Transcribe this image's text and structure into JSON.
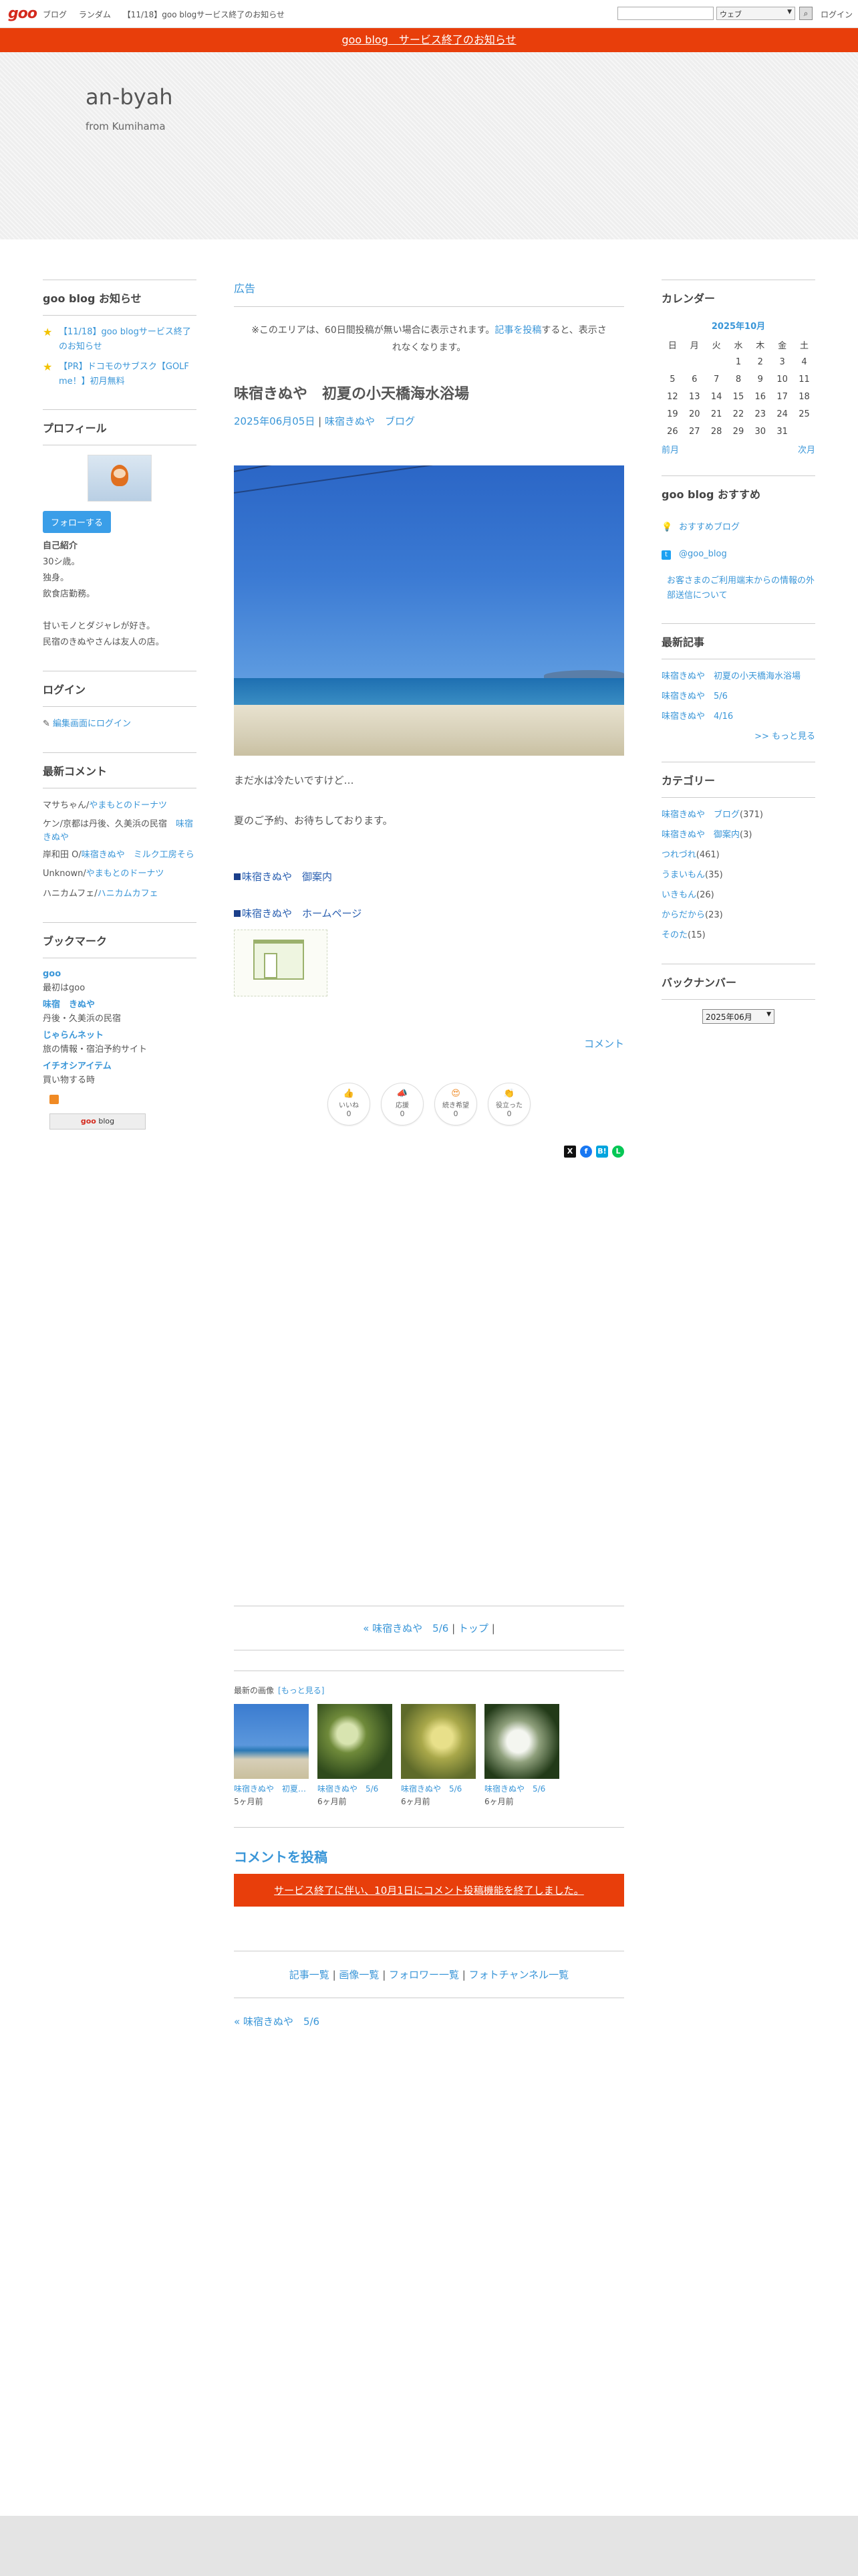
{
  "topbar": {
    "logo": "goo",
    "nav": [
      "ブログ",
      "ランダム",
      "【11/18】goo blogサービス終了のお知らせ"
    ],
    "search_select": "ウェブ",
    "search_button": "🔍",
    "login": "ログイン"
  },
  "notice": {
    "text": "goo blog　サービス終了のお知らせ"
  },
  "header": {
    "title": "an-byah",
    "subtitle": "from Kumihama"
  },
  "left": {
    "goo_notice": {
      "title": "goo blog お知らせ",
      "items": [
        "【11/18】goo blogサービス終了のお知らせ",
        "【PR】ドコモのサブスク【GOLF me！】初月無料"
      ]
    },
    "profile": {
      "title": "プロフィール",
      "follow": "フォローする",
      "intro_label": "自己紹介",
      "lines": [
        "30シ歳。",
        "独身。",
        "飲食店勤務。",
        "",
        "甘いモノとダジャレが好き。",
        "民宿のきぬやさんは友人の店。"
      ]
    },
    "login": {
      "title": "ログイン",
      "link": "編集画面にログイン"
    },
    "comments": {
      "title": "最新コメント",
      "items": [
        {
          "author": "マサちゃん/",
          "link": "やまもとのドーナツ"
        },
        {
          "author": "ケン/京都は丹後、久美浜の民宿　",
          "link": "味宿きぬや"
        },
        {
          "author": "岸和田 O/",
          "link": "味宿きぬや　ミルク工房そら"
        },
        {
          "author": "Unknown/",
          "link": "やまもとのドーナツ"
        },
        {
          "author": "ハニカムフェ/",
          "link": "ハニカムカフェ"
        }
      ]
    },
    "bookmarks": {
      "title": "ブックマーク",
      "items": [
        {
          "name": "goo",
          "desc": "最初はgoo"
        },
        {
          "name": "味宿　きぬや",
          "desc": "丹後・久美浜の民宿"
        },
        {
          "name": "じゃらんネット",
          "desc": "旅の情報・宿泊予約サイト"
        },
        {
          "name": "イチオシアイテム",
          "desc": "買い物する時"
        }
      ]
    },
    "badge_prefix": "goo",
    "badge_suffix": " blog"
  },
  "main": {
    "ad_label": "広告",
    "ad_note_pre": "※このエリアは、60日間投稿が無い場合に表示されます。",
    "ad_note_link": "記事を投稿",
    "ad_note_post": "すると、表示されなくなります。",
    "post": {
      "title": "味宿きぬや　初夏の小天橋海水浴場",
      "date": "2025年06月05日",
      "meta_sep": " | ",
      "category": "味宿きぬや　ブログ",
      "text1": "まだ水は冷たいですけど…",
      "text2": "夏のご予約、お待ちしております。",
      "link1": "味宿きぬや　御案内",
      "link2": "味宿きぬや　ホームページ",
      "comment": "コメント"
    },
    "reactions": [
      {
        "top": "いいね",
        "label": "いいね",
        "icon": "👍",
        "count": "0"
      },
      {
        "top": "応援",
        "label": "応援",
        "icon": "📣",
        "count": "0"
      },
      {
        "top": "続き希望",
        "label": "続き希望",
        "icon": "😍",
        "count": "0"
      },
      {
        "top": "役立った",
        "label": "役立った",
        "icon": "👏",
        "count": "0"
      }
    ],
    "shares": [
      "X",
      "f",
      "B!",
      "L"
    ],
    "pager": {
      "prev": "« 味宿きぬや　5/6",
      "sep1": " | ",
      "top": "トップ",
      "sep2": " |"
    },
    "recent_images": {
      "head": "最新の画像",
      "more": "[もっと見る]",
      "items": [
        {
          "cap": "味宿きぬや　初夏…",
          "age": "5ヶ月前",
          "c1": "#3b7cd0",
          "c2": "#d7cfb8"
        },
        {
          "cap": "味宿きぬや　5/6",
          "age": "6ヶ月前",
          "c1": "#2f4a1c",
          "c2": "#b9c98a"
        },
        {
          "cap": "味宿きぬや　5/6",
          "age": "6ヶ月前",
          "c1": "#5e6a2a",
          "c2": "#d8d080"
        },
        {
          "cap": "味宿きぬや　5/6",
          "age": "6ヶ月前",
          "c1": "#223a18",
          "c2": "#e8efe4"
        }
      ]
    },
    "comment_post": {
      "title": "コメントを投稿",
      "bar": "サービス終了に伴い、10月1日にコメント投稿機能を終了しました。"
    },
    "footer_links": [
      "記事一覧",
      "画像一覧",
      "フォロワー一覧",
      "フォトチャンネル一覧"
    ],
    "footer_sep": " | ",
    "prev_link": "« 味宿きぬや　5/6"
  },
  "right": {
    "calendar": {
      "title": "カレンダー",
      "month": "2025年10月",
      "days": [
        "日",
        "月",
        "火",
        "水",
        "木",
        "金",
        "土"
      ],
      "weeks": [
        [
          "",
          "",
          "",
          "1",
          "2",
          "3",
          "4"
        ],
        [
          "5",
          "6",
          "7",
          "8",
          "9",
          "10",
          "11"
        ],
        [
          "12",
          "13",
          "14",
          "15",
          "16",
          "17",
          "18"
        ],
        [
          "19",
          "20",
          "21",
          "22",
          "23",
          "24",
          "25"
        ],
        [
          "26",
          "27",
          "28",
          "29",
          "30",
          "31",
          ""
        ]
      ],
      "prev": "前月",
      "next": "次月"
    },
    "recommend": {
      "title": "goo blog おすすめ",
      "items": [
        "おすすめブログ",
        "@goo_blog",
        "お客さまのご利用端末からの情報の外部送信について"
      ]
    },
    "latest": {
      "title": "最新記事",
      "items": [
        "味宿きぬや　初夏の小天橋海水浴場",
        "味宿きぬや　5/6",
        "味宿きぬや　4/16"
      ],
      "more": ">> もっと見る"
    },
    "categories": {
      "title": "カテゴリー",
      "items": [
        {
          "name": "味宿きぬや　ブログ",
          "count": "(371)"
        },
        {
          "name": "味宿きぬや　御案内",
          "count": "(3)"
        },
        {
          "name": "つれづれ",
          "count": "(461)"
        },
        {
          "name": "うまいもん",
          "count": "(35)"
        },
        {
          "name": "いきもん",
          "count": "(26)"
        },
        {
          "name": "からだから",
          "count": "(23)"
        },
        {
          "name": "そのた",
          "count": "(15)"
        }
      ]
    },
    "backnumber": {
      "title": "バックナンバー",
      "selected": "2025年06月"
    }
  }
}
